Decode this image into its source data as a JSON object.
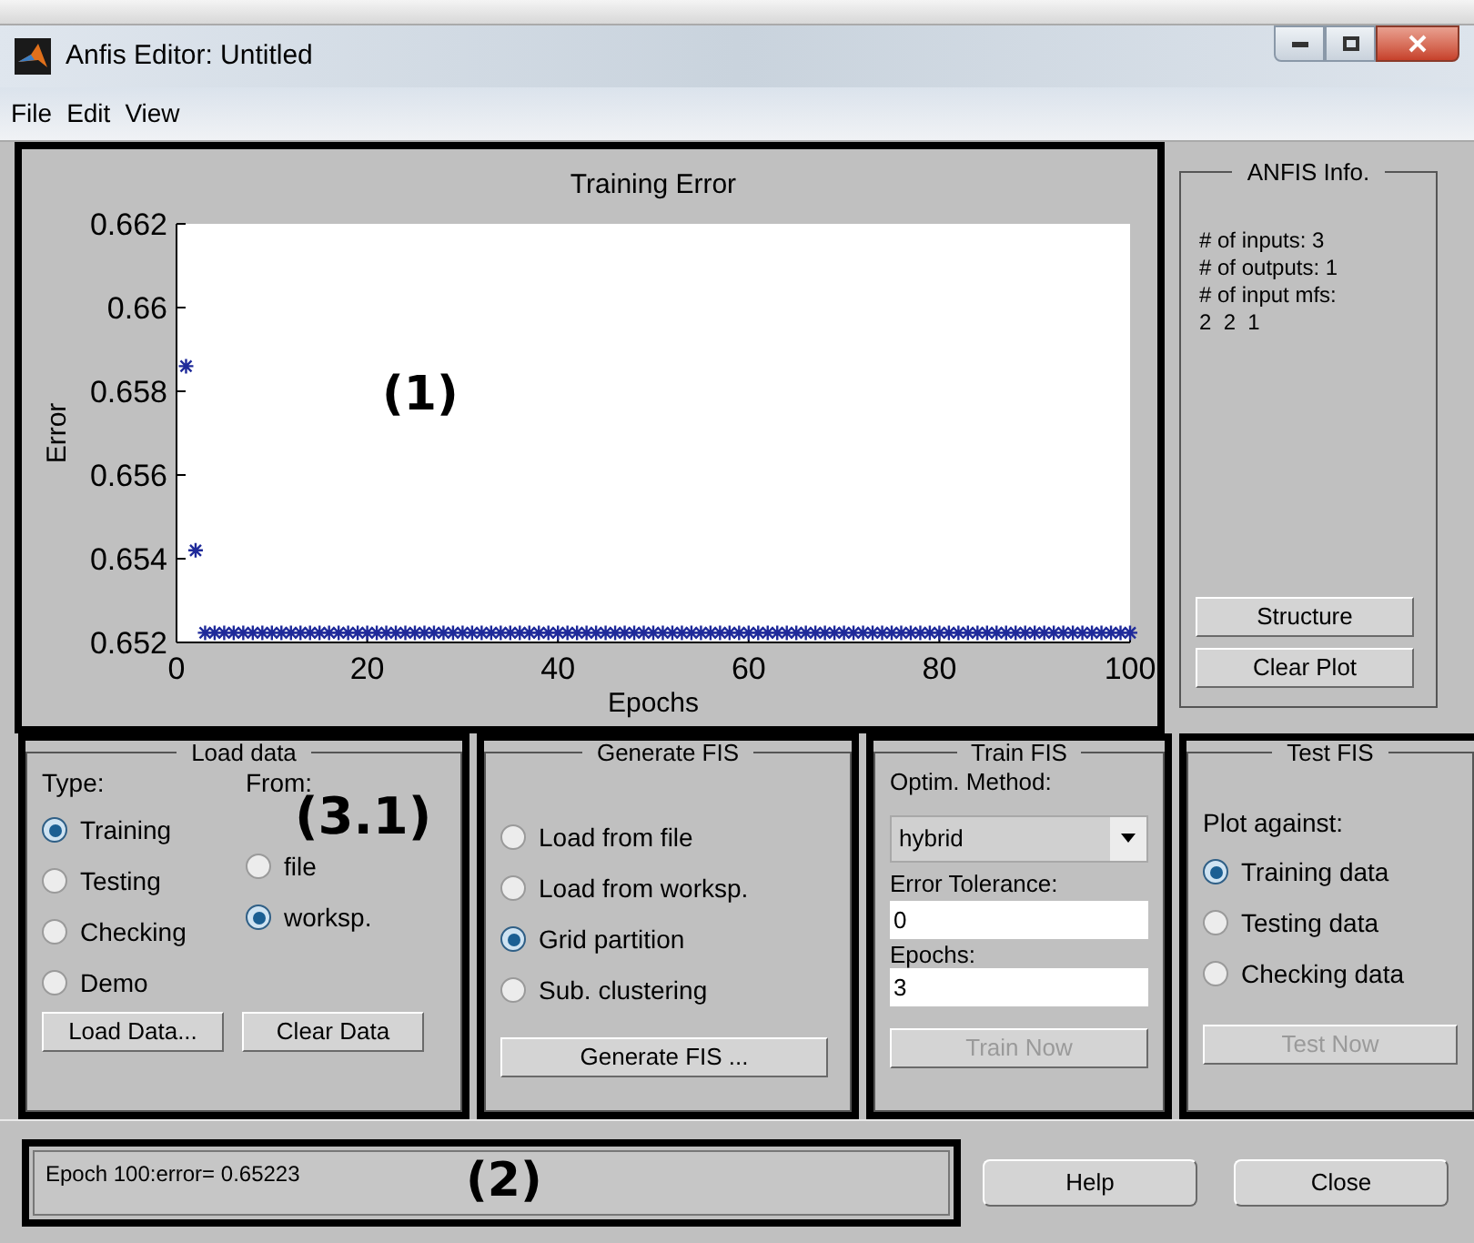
{
  "window": {
    "title": "Anfis Editor: Untitled"
  },
  "menu": [
    "File",
    "Edit",
    "View"
  ],
  "plot": {
    "annotation": "(1)",
    "chart_data": {
      "type": "scatter",
      "title": "Training Error",
      "xlabel": "Epochs",
      "ylabel": "Error",
      "x": [
        1,
        2,
        3,
        4,
        5,
        6,
        7,
        8,
        9,
        10,
        11,
        12,
        13,
        14,
        15,
        16,
        17,
        18,
        19,
        20,
        21,
        22,
        23,
        24,
        25,
        26,
        27,
        28,
        29,
        30,
        31,
        32,
        33,
        34,
        35,
        36,
        37,
        38,
        39,
        40,
        41,
        42,
        43,
        44,
        45,
        46,
        47,
        48,
        49,
        50,
        51,
        52,
        53,
        54,
        55,
        56,
        57,
        58,
        59,
        60,
        61,
        62,
        63,
        64,
        65,
        66,
        67,
        68,
        69,
        70,
        71,
        72,
        73,
        74,
        75,
        76,
        77,
        78,
        79,
        80,
        81,
        82,
        83,
        84,
        85,
        86,
        87,
        88,
        89,
        90,
        91,
        92,
        93,
        94,
        95,
        96,
        97,
        98,
        99,
        100
      ],
      "series": [
        {
          "color": "#1f2a9a",
          "values": [
            0.6586,
            0.6542,
            0.65223,
            0.65223,
            0.65223,
            0.65223,
            0.65223,
            0.65223,
            0.65223,
            0.65223,
            0.65223,
            0.65223,
            0.65223,
            0.65223,
            0.65223,
            0.65223,
            0.65223,
            0.65223,
            0.65223,
            0.65223,
            0.65223,
            0.65223,
            0.65223,
            0.65223,
            0.65223,
            0.65223,
            0.65223,
            0.65223,
            0.65223,
            0.65223,
            0.65223,
            0.65223,
            0.65223,
            0.65223,
            0.65223,
            0.65223,
            0.65223,
            0.65223,
            0.65223,
            0.65223,
            0.65223,
            0.65223,
            0.65223,
            0.65223,
            0.65223,
            0.65223,
            0.65223,
            0.65223,
            0.65223,
            0.65223,
            0.65223,
            0.65223,
            0.65223,
            0.65223,
            0.65223,
            0.65223,
            0.65223,
            0.65223,
            0.65223,
            0.65223,
            0.65223,
            0.65223,
            0.65223,
            0.65223,
            0.65223,
            0.65223,
            0.65223,
            0.65223,
            0.65223,
            0.65223,
            0.65223,
            0.65223,
            0.65223,
            0.65223,
            0.65223,
            0.65223,
            0.65223,
            0.65223,
            0.65223,
            0.65223,
            0.65223,
            0.65223,
            0.65223,
            0.65223,
            0.65223,
            0.65223,
            0.65223,
            0.65223,
            0.65223,
            0.65223,
            0.65223,
            0.65223,
            0.65223,
            0.65223,
            0.65223,
            0.65223,
            0.65223,
            0.65223,
            0.65223,
            0.65223
          ]
        }
      ],
      "xlim": [
        0,
        100
      ],
      "ylim": [
        0.652,
        0.662
      ],
      "xticks": [
        0,
        20,
        40,
        60,
        80,
        100
      ],
      "yticks": [
        0.652,
        0.654,
        0.656,
        0.658,
        0.66,
        0.662
      ]
    }
  },
  "anfis_info": {
    "title": "ANFIS Info.",
    "lines": [
      "# of inputs: 3",
      "# of outputs: 1",
      "# of input mfs:",
      "2  2  1"
    ],
    "buttons": [
      "Structure",
      "Clear Plot"
    ]
  },
  "load_data": {
    "title": "Load data",
    "annotation": "(3.1)",
    "type_label": "Type:",
    "from_label": "From:",
    "types": [
      {
        "label": "Training",
        "selected": true
      },
      {
        "label": "Testing",
        "selected": false
      },
      {
        "label": "Checking",
        "selected": false
      },
      {
        "label": "Demo",
        "selected": false
      }
    ],
    "sources": [
      {
        "label": "file",
        "selected": false
      },
      {
        "label": "worksp.",
        "selected": true
      }
    ],
    "buttons": [
      "Load Data...",
      "Clear Data"
    ]
  },
  "generate_fis": {
    "title": "Generate FIS",
    "options": [
      {
        "label": "Load from file",
        "selected": false
      },
      {
        "label": "Load from worksp.",
        "selected": false
      },
      {
        "label": "Grid partition",
        "selected": true
      },
      {
        "label": "Sub. clustering",
        "selected": false
      }
    ],
    "button": "Generate FIS ..."
  },
  "train_fis": {
    "title": "Train FIS",
    "method_label": "Optim. Method:",
    "method": "hybrid",
    "tolerance_label": "Error Tolerance:",
    "tolerance": "0",
    "epochs_label": "Epochs:",
    "epochs": "3",
    "button": {
      "label": "Train Now",
      "disabled": true
    }
  },
  "test_fis": {
    "title": "Test FIS",
    "plot_label": "Plot against:",
    "options": [
      {
        "label": "Training data",
        "selected": true
      },
      {
        "label": "Testing data",
        "selected": false
      },
      {
        "label": "Checking data",
        "selected": false
      }
    ],
    "button": {
      "label": "Test Now",
      "disabled": true
    }
  },
  "status": {
    "text": "Epoch 100:error= 0.65223",
    "annotation": "(2)"
  },
  "buttons": [
    "Help",
    "Close"
  ]
}
